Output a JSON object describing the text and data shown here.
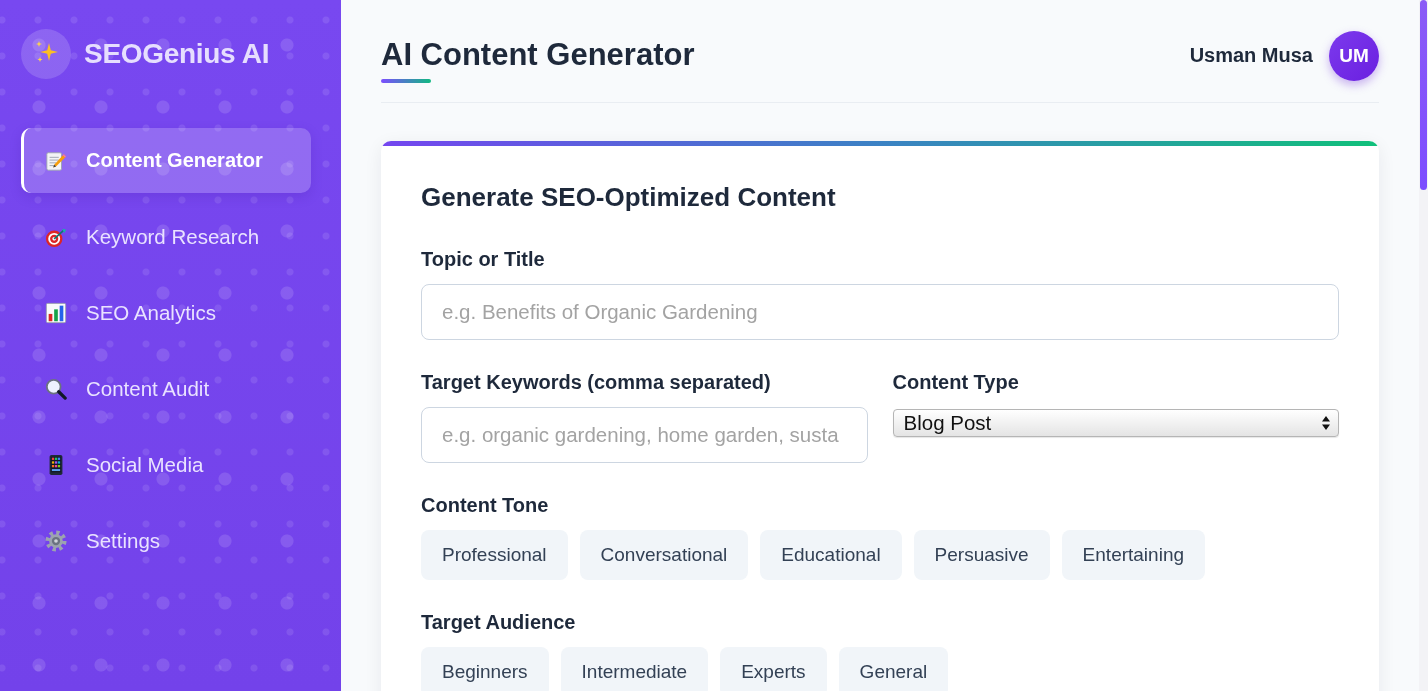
{
  "sidebar": {
    "logo_text": "SEOGenius AI",
    "items": [
      {
        "label": "Content Generator",
        "selected": true
      },
      {
        "label": "Keyword Research",
        "selected": false
      },
      {
        "label": "SEO Analytics",
        "selected": false
      },
      {
        "label": "Content Audit",
        "selected": false
      },
      {
        "label": "Social Media",
        "selected": false
      },
      {
        "label": "Settings",
        "selected": false
      }
    ]
  },
  "header": {
    "title": "AI Content Generator",
    "user_name": "Usman Musa",
    "avatar_initials": "UM"
  },
  "card": {
    "title": "Generate SEO-Optimized Content",
    "topic": {
      "label": "Topic or Title",
      "placeholder": "e.g. Benefits of Organic Gardening"
    },
    "keywords": {
      "label": "Target Keywords (comma separated)",
      "placeholder": "e.g. organic gardening, home garden, susta"
    },
    "content_type": {
      "label": "Content Type",
      "value": "Blog Post"
    },
    "tone": {
      "label": "Content Tone",
      "options": [
        {
          "label": "Professional",
          "selected": false
        },
        {
          "label": "Conversational",
          "selected": false
        },
        {
          "label": "Educational",
          "selected": false
        },
        {
          "label": "Persuasive",
          "selected": false
        },
        {
          "label": "Entertaining",
          "selected": false
        }
      ]
    },
    "audience": {
      "label": "Target Audience",
      "options": [
        {
          "label": "Beginners",
          "selected": false
        },
        {
          "label": "Intermediate",
          "selected": false
        },
        {
          "label": "Experts",
          "selected": false
        },
        {
          "label": "General",
          "selected": false
        }
      ]
    }
  }
}
